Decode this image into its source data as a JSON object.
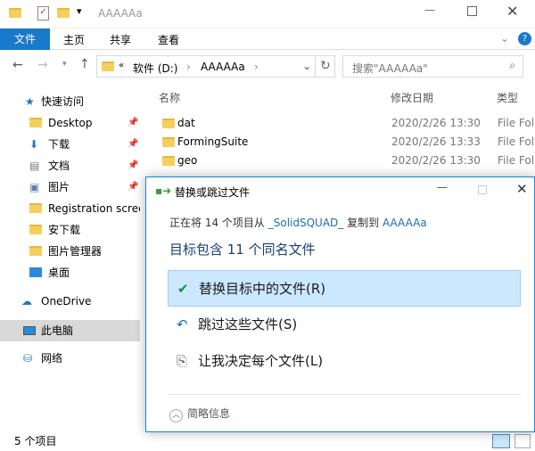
{
  "window": {
    "title": "AAAAAa"
  },
  "ribbon": {
    "tabs": [
      "文件",
      "主页",
      "共享",
      "查看"
    ]
  },
  "address": {
    "prefix": "«",
    "segments": [
      "软件 (D:)",
      "AAAAAa"
    ],
    "search_placeholder": "搜索\"AAAAAa\""
  },
  "columns": {
    "name": "名称",
    "date": "修改日期",
    "type": "类型"
  },
  "sidebar": {
    "items": [
      {
        "label": "快速访问",
        "icon": "star-icon"
      },
      {
        "label": "Desktop",
        "icon": "folder-icon",
        "pinned": true
      },
      {
        "label": "下载",
        "icon": "download-icon",
        "pinned": true
      },
      {
        "label": "文档",
        "icon": "document-icon",
        "pinned": true
      },
      {
        "label": "图片",
        "icon": "picture-icon",
        "pinned": true
      },
      {
        "label": "Registration scree",
        "icon": "folder-icon"
      },
      {
        "label": "安下载",
        "icon": "folder-icon"
      },
      {
        "label": "图片管理器",
        "icon": "folder-icon"
      },
      {
        "label": "桌面",
        "icon": "desktop-icon"
      },
      {
        "label": "OneDrive",
        "icon": "cloud-icon"
      },
      {
        "label": "此电脑",
        "icon": "computer-icon",
        "selected": true
      },
      {
        "label": "网络",
        "icon": "network-icon"
      }
    ]
  },
  "files": [
    {
      "name": "dat",
      "date": "2020/2/26 13:30",
      "type": "File Fol"
    },
    {
      "name": "FormingSuite",
      "date": "2020/2/26 13:33",
      "type": "File Fol"
    },
    {
      "name": "geo",
      "date": "2020/2/26 13:30",
      "type": "File Fol"
    }
  ],
  "status": {
    "count": "5 个项目"
  },
  "dialog": {
    "title": "替换或跳过文件",
    "line1_a": "正在将 14 个项目从",
    "source": "_SolidSQUAD_",
    "line1_b": "复制到",
    "dest": "AAAAAa",
    "headline": "目标包含 11 个同名文件",
    "options": [
      "替换目标中的文件(R)",
      "跳过这些文件(S)",
      "让我决定每个文件(L)"
    ],
    "details": "简略信息"
  },
  "colors": {
    "accent": "#1979ca",
    "selected_option": "#cce8ff",
    "link": "#1c6fb5"
  }
}
